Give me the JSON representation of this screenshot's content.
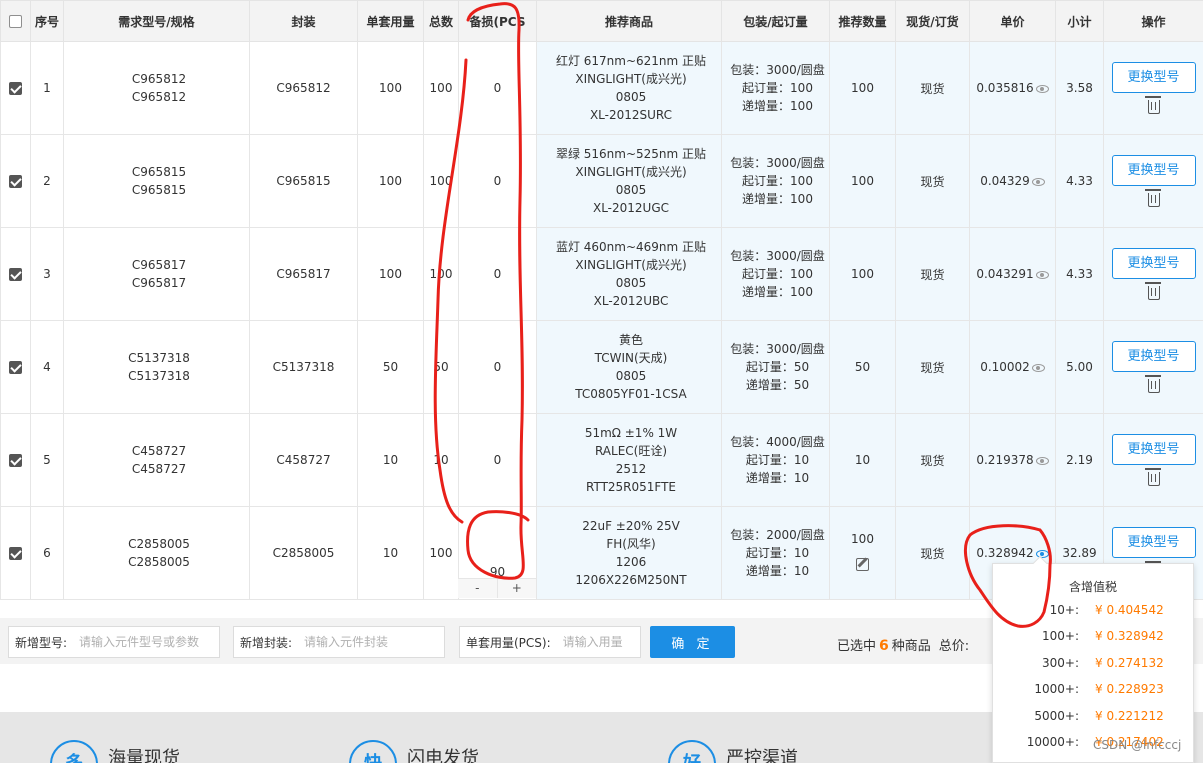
{
  "columns": [
    "",
    "序号",
    "需求型号/规格",
    "封装",
    "单套用量",
    "总数",
    "备损(PCS",
    "推荐商品",
    "包装/起订量",
    "推荐数量",
    "现货/订货",
    "单价",
    "小计",
    "操作"
  ],
  "rows": [
    {
      "no": "1",
      "part1": "C965812",
      "part2": "C965812",
      "package": "C965812",
      "per_set": "100",
      "total": "100",
      "spare": "0",
      "rec1": "红灯 617nm~621nm 正贴",
      "rec2": "XINGLIGHT(成兴光)",
      "rec3": "0805",
      "rec4": "XL-2012SURC",
      "pack1": "包装：3000/圆盘",
      "pack2": "起订量：100",
      "pack3": "递增量：100",
      "rec_qty": "100",
      "stock": "现货",
      "price": "0.035816",
      "subtotal": "3.58"
    },
    {
      "no": "2",
      "part1": "C965815",
      "part2": "C965815",
      "package": "C965815",
      "per_set": "100",
      "total": "100",
      "spare": "0",
      "rec1": "翠绿 516nm~525nm 正贴",
      "rec2": "XINGLIGHT(成兴光)",
      "rec3": "0805",
      "rec4": "XL-2012UGC",
      "pack1": "包装：3000/圆盘",
      "pack2": "起订量：100",
      "pack3": "递增量：100",
      "rec_qty": "100",
      "stock": "现货",
      "price": "0.04329",
      "subtotal": "4.33"
    },
    {
      "no": "3",
      "part1": "C965817",
      "part2": "C965817",
      "package": "C965817",
      "per_set": "100",
      "total": "100",
      "spare": "0",
      "rec1": "蓝灯 460nm~469nm 正贴",
      "rec2": "XINGLIGHT(成兴光)",
      "rec3": "0805",
      "rec4": "XL-2012UBC",
      "pack1": "包装：3000/圆盘",
      "pack2": "起订量：100",
      "pack3": "递增量：100",
      "rec_qty": "100",
      "stock": "现货",
      "price": "0.043291",
      "subtotal": "4.33"
    },
    {
      "no": "4",
      "part1": "C5137318",
      "part2": "C5137318",
      "package": "C5137318",
      "per_set": "50",
      "total": "50",
      "spare": "0",
      "rec1": "黄色",
      "rec2": "TCWIN(天成)",
      "rec3": "0805",
      "rec4": "TC0805YF01-1CSA",
      "pack1": "包装：3000/圆盘",
      "pack2": "起订量：50",
      "pack3": "递增量：50",
      "rec_qty": "50",
      "stock": "现货",
      "price": "0.10002",
      "subtotal": "5.00"
    },
    {
      "no": "5",
      "part1": "C458727",
      "part2": "C458727",
      "package": "C458727",
      "per_set": "10",
      "total": "10",
      "spare": "0",
      "rec1": "51mΩ ±1% 1W",
      "rec2": "RALEC(旺诠)",
      "rec3": "2512",
      "rec4": "RTT25R051FTE",
      "pack1": "包装：4000/圆盘",
      "pack2": "起订量：10",
      "pack3": "递增量：10",
      "rec_qty": "10",
      "stock": "现货",
      "price": "0.219378",
      "subtotal": "2.19"
    },
    {
      "no": "6",
      "part1": "C2858005",
      "part2": "C2858005",
      "package": "C2858005",
      "per_set": "10",
      "total": "100",
      "spare": "90",
      "rec1": "22uF ±20% 25V",
      "rec2": "FH(风华)",
      "rec3": "1206",
      "rec4": "1206X226M250NT",
      "pack1": "包装：2000/圆盘",
      "pack2": "起订量：10",
      "pack3": "递增量：10",
      "rec_qty": "100",
      "stock": "现货",
      "price": "0.328942",
      "subtotal": "32.89"
    }
  ],
  "swap_label": "更换型号",
  "stepper": {
    "minus": "-",
    "plus": "+"
  },
  "addbar": {
    "model_label": "新增型号:",
    "model_placeholder": "请输入元件型号或参数",
    "package_label": "新增封装:",
    "package_placeholder": "请输入元件封装",
    "usage_label": "单套用量(PCS):",
    "usage_placeholder": "请输入用量",
    "confirm": "确 定",
    "selected_prefix": "已选中",
    "selected_count": "6",
    "selected_suffix": "种商品",
    "total_label": "总价:"
  },
  "price_popup": {
    "title": "含增值税",
    "tiers": [
      {
        "qty": "10+:",
        "price": "¥ 0.404542"
      },
      {
        "qty": "100+:",
        "price": "¥ 0.328942"
      },
      {
        "qty": "300+:",
        "price": "¥ 0.274132"
      },
      {
        "qty": "1000+:",
        "price": "¥ 0.228923"
      },
      {
        "qty": "5000+:",
        "price": "¥ 0.221212"
      },
      {
        "qty": "10000+:",
        "price": "¥ 0.217402"
      }
    ]
  },
  "features": [
    {
      "icon": "多",
      "label": "海量现货"
    },
    {
      "icon": "快",
      "label": "闪电发货"
    },
    {
      "icon": "好",
      "label": "严控渠道"
    }
  ],
  "watermark": "CSDN @lnfcccj",
  "colors": {
    "accent": "#1c8ee4",
    "price": "#ff7a00",
    "annotation": "#e8201a",
    "recommend_bg": "#f0f8fd"
  }
}
